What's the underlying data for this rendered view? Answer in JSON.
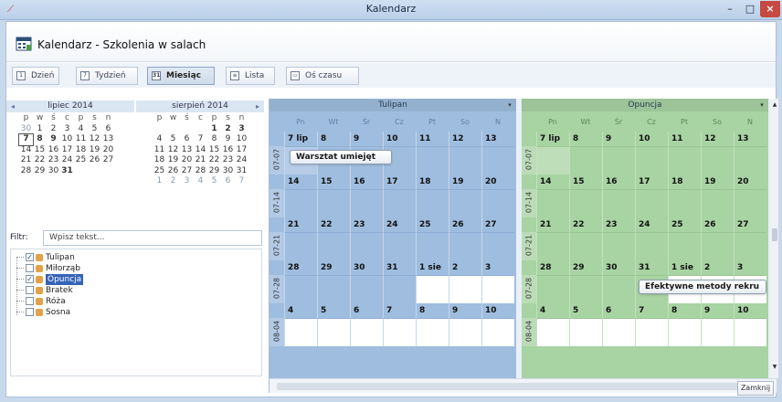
{
  "window": {
    "title": "Kalendarz",
    "minimize": "–",
    "maximize": "□",
    "close": "×"
  },
  "header": {
    "title": "Kalendarz - Szkolenia w salach"
  },
  "toolbar": {
    "day": "Dzień",
    "week": "Tydzień",
    "month": "Miesiąc",
    "list": "Lista",
    "timeline": "Oś czasu",
    "day_icon": "1",
    "week_icon": "7",
    "month_icon": "31",
    "list_icon": "≡",
    "timeline_icon": "▭"
  },
  "mini_calendar": {
    "prev": "◂",
    "next": "▸",
    "months": [
      {
        "title": "lipiec 2014",
        "day_names": [
          "p",
          "w",
          "ś",
          "c",
          "p",
          "s",
          "n"
        ],
        "weeks": [
          [
            "30",
            "1",
            "2",
            "3",
            "4",
            "5",
            "6"
          ],
          [
            "7",
            "8",
            "9",
            "10",
            "11",
            "12",
            "13"
          ],
          [
            "14",
            "15",
            "16",
            "17",
            "18",
            "19",
            "20"
          ],
          [
            "21",
            "22",
            "23",
            "24",
            "25",
            "26",
            "27"
          ],
          [
            "28",
            "29",
            "30",
            "31",
            "",
            "",
            ""
          ]
        ]
      },
      {
        "title": "sierpień 2014",
        "day_names": [
          "p",
          "w",
          "ś",
          "c",
          "p",
          "s",
          "n"
        ],
        "weeks": [
          [
            "",
            "",
            "",
            "",
            "1",
            "2",
            "3"
          ],
          [
            "4",
            "5",
            "6",
            "7",
            "8",
            "9",
            "10"
          ],
          [
            "11",
            "12",
            "13",
            "14",
            "15",
            "16",
            "17"
          ],
          [
            "18",
            "19",
            "20",
            "21",
            "22",
            "23",
            "24"
          ],
          [
            "25",
            "26",
            "27",
            "28",
            "29",
            "30",
            "31"
          ],
          [
            "1",
            "2",
            "3",
            "4",
            "5",
            "6",
            "7"
          ]
        ]
      }
    ]
  },
  "filter": {
    "label": "Filtr:",
    "placeholder": "Wpisz tekst..."
  },
  "resources": [
    {
      "name": "Tulipan",
      "checked": "✓"
    },
    {
      "name": "Miłorząb",
      "checked": ""
    },
    {
      "name": "Opuncja",
      "checked": "✓"
    },
    {
      "name": "Bratek",
      "checked": ""
    },
    {
      "name": "Róża",
      "checked": ""
    },
    {
      "name": "Sosna",
      "checked": ""
    }
  ],
  "calendar": {
    "day_headers": [
      "Pn",
      "Wt",
      "Śr",
      "Cz",
      "Pt",
      "So",
      "N"
    ],
    "week_labels": [
      "07-07",
      "07-14",
      "07-21",
      "07-28",
      "08-04"
    ],
    "weeks": [
      [
        "7 lip",
        "8",
        "9",
        "10",
        "11",
        "12",
        "13"
      ],
      [
        "14",
        "15",
        "16",
        "17",
        "18",
        "19",
        "20"
      ],
      [
        "21",
        "22",
        "23",
        "24",
        "25",
        "26",
        "27"
      ],
      [
        "28",
        "29",
        "30",
        "31",
        "1 sie",
        "2",
        "3"
      ],
      [
        "4",
        "5",
        "6",
        "7",
        "8",
        "9",
        "10"
      ]
    ],
    "panes": [
      {
        "title": "Tulipan",
        "drop": "▾",
        "color": "#9fbddf",
        "event": "Warsztat umiejęt"
      },
      {
        "title": "Opuncja",
        "drop": "▾",
        "color": "#a8d3a3",
        "event": "Efektywne metody rekru"
      }
    ]
  },
  "footer": {
    "close": "Zamknij"
  }
}
